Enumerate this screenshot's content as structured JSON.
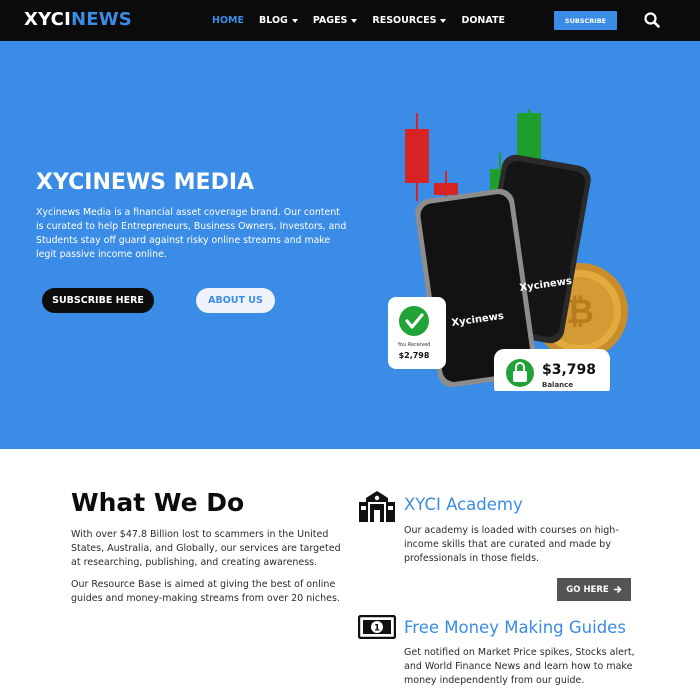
{
  "header": {
    "logo_part1": "XYCI",
    "logo_part2": "NEWS",
    "nav": [
      {
        "label": "HOME",
        "active": true,
        "dropdown": false
      },
      {
        "label": "BLOG",
        "active": false,
        "dropdown": true
      },
      {
        "label": "PAGES",
        "active": false,
        "dropdown": true
      },
      {
        "label": "RESOURCES",
        "active": false,
        "dropdown": true
      },
      {
        "label": "DONATE",
        "active": false,
        "dropdown": false
      }
    ],
    "subscribe_label": "SUBSCRIBE",
    "search_icon": "search-icon"
  },
  "hero": {
    "title": "XYCINEWS MEDIA",
    "description": "Xycinews Media is a financial asset coverage brand. Our content is curated to help Entrepreneurs, Business Owners, Investors, and Students stay off guard against risky online streams and make legit passive income online.",
    "primary_button": "SUBSCRIBE HERE",
    "secondary_button": "ABOUT US",
    "art": {
      "phone_brand": "Xycinews",
      "received_label": "You Received",
      "received_amount": "$2,798",
      "balance_amount": "$3,798",
      "balance_label": "Balance"
    }
  },
  "what_we_do": {
    "title": "What We Do",
    "paragraph1": "With over $47.8 Billion lost to scammers in the United States, Australia, and Globally, our services are targeted at researching, publishing, and creating awareness.",
    "paragraph2": "Our Resource Base is aimed at giving the best of online guides and money-making streams from over 20 niches."
  },
  "academy": {
    "title": "XYCI Academy",
    "description": "Our academy is loaded with courses on high-income skills that are curated and made by professionals in those fields.",
    "button": "GO HERE"
  },
  "guides": {
    "title": "Free Money Making Guides",
    "description": "Get notified on Market Price spikes, Stocks alert, and World Finance News and learn how to make money independently from our guide."
  },
  "colors": {
    "accent": "#3a8ce6",
    "header_bg": "#0b0b0b",
    "dark_button": "#0d0d0d",
    "grey_button": "#545454",
    "candle_red": "#d62424",
    "candle_green": "#1f9e2e",
    "check_green": "#22a33a"
  }
}
